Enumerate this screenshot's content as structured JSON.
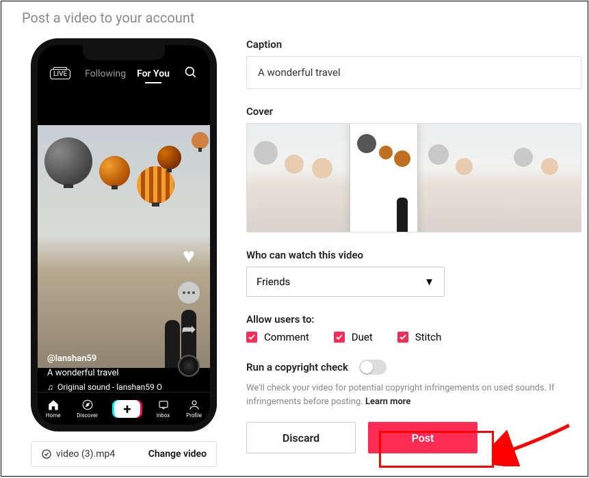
{
  "page_title": "Post a video to your account",
  "phone": {
    "tabs": {
      "following": "Following",
      "for_you": "For You"
    },
    "meta": {
      "user": "@lanshan59",
      "caption": "A wonderful travel",
      "sound": "Original sound - lanshan59 O"
    },
    "nav": {
      "home": "Home",
      "discover": "Discover",
      "inbox": "Inbox",
      "profile": "Profile"
    }
  },
  "file": {
    "name": "video (3).mp4",
    "change": "Change video"
  },
  "form": {
    "caption_label": "Caption",
    "caption_value": "A wonderful travel",
    "cover_label": "Cover",
    "privacy_label": "Who can watch this video",
    "privacy_value": "Friends",
    "allow_label": "Allow users to:",
    "allow": {
      "comment": "Comment",
      "duet": "Duet",
      "stitch": "Stitch"
    },
    "copyright_label": "Run a copyright check",
    "copyright_desc_a": "We'll check your video for potential copyright infringements on used sounds. If infringements",
    "copyright_desc_b": "before posting.",
    "learn_more": "Learn more",
    "discard": "Discard",
    "post": "Post"
  }
}
